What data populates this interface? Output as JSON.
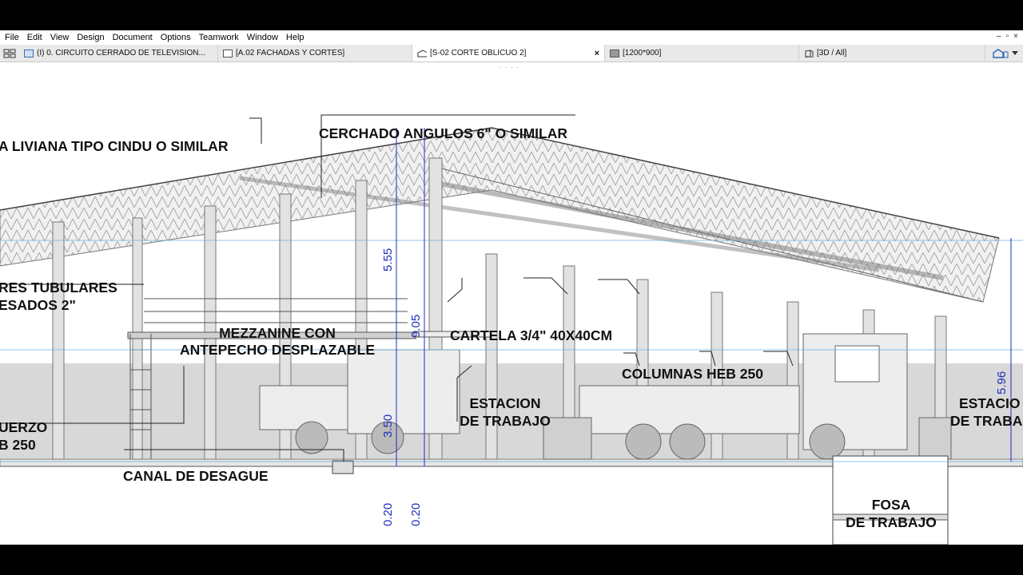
{
  "menu": [
    "File",
    "Edit",
    "View",
    "Design",
    "Document",
    "Options",
    "Teamwork",
    "Window",
    "Help"
  ],
  "tabs": [
    {
      "label": "(I) 0. CIRCUITO CERRADO DE TELEVISION...",
      "icon": "floor-plan-icon",
      "active": false
    },
    {
      "label": "[A.02 FACHADAS Y CORTES]",
      "icon": "layout-icon",
      "active": false
    },
    {
      "label": "[S-02 CORTE OBLICUO 2]",
      "icon": "section-icon",
      "active": true,
      "close": "×"
    },
    {
      "label": "[1200*900]",
      "icon": "worksheet-icon",
      "active": false
    },
    {
      "label": "[3D / All]",
      "icon": "3d-view-icon",
      "active": false
    }
  ],
  "window_controls": [
    "–",
    "▫",
    "×"
  ],
  "drawing": {
    "annotations": {
      "roof_cover": "A LIVIANA TIPO CINDU O SIMILAR",
      "truss": "CERCHADO ANGULOS 6\" O SIMILAR",
      "tubular_1": "RES TUBULARES",
      "tubular_2": "ESADOS 2\"",
      "mezzanine_1": "MEZZANINE CON",
      "mezzanine_2": "ANTEPECHO DESPLAZABLE",
      "cartela": "CARTELA 3/4\" 40X40CM",
      "columns": "COLUMNAS HEB 250",
      "station_1a": "ESTACION",
      "station_1b": "DE TRABAJO",
      "station_2a": "ESTACIO",
      "station_2b": "DE TRABA",
      "reinforce_1": "UERZO",
      "reinforce_2": "B 250",
      "drain": "CANAL DE DESAGUE",
      "pit_1": "FOSA",
      "pit_2": "DE TRABAJO"
    },
    "dimensions": {
      "d1": "5.55",
      "d2": "9.05",
      "d3": "3.50",
      "d4": "0.20",
      "d5": "0.20",
      "d6": "5.96"
    }
  }
}
